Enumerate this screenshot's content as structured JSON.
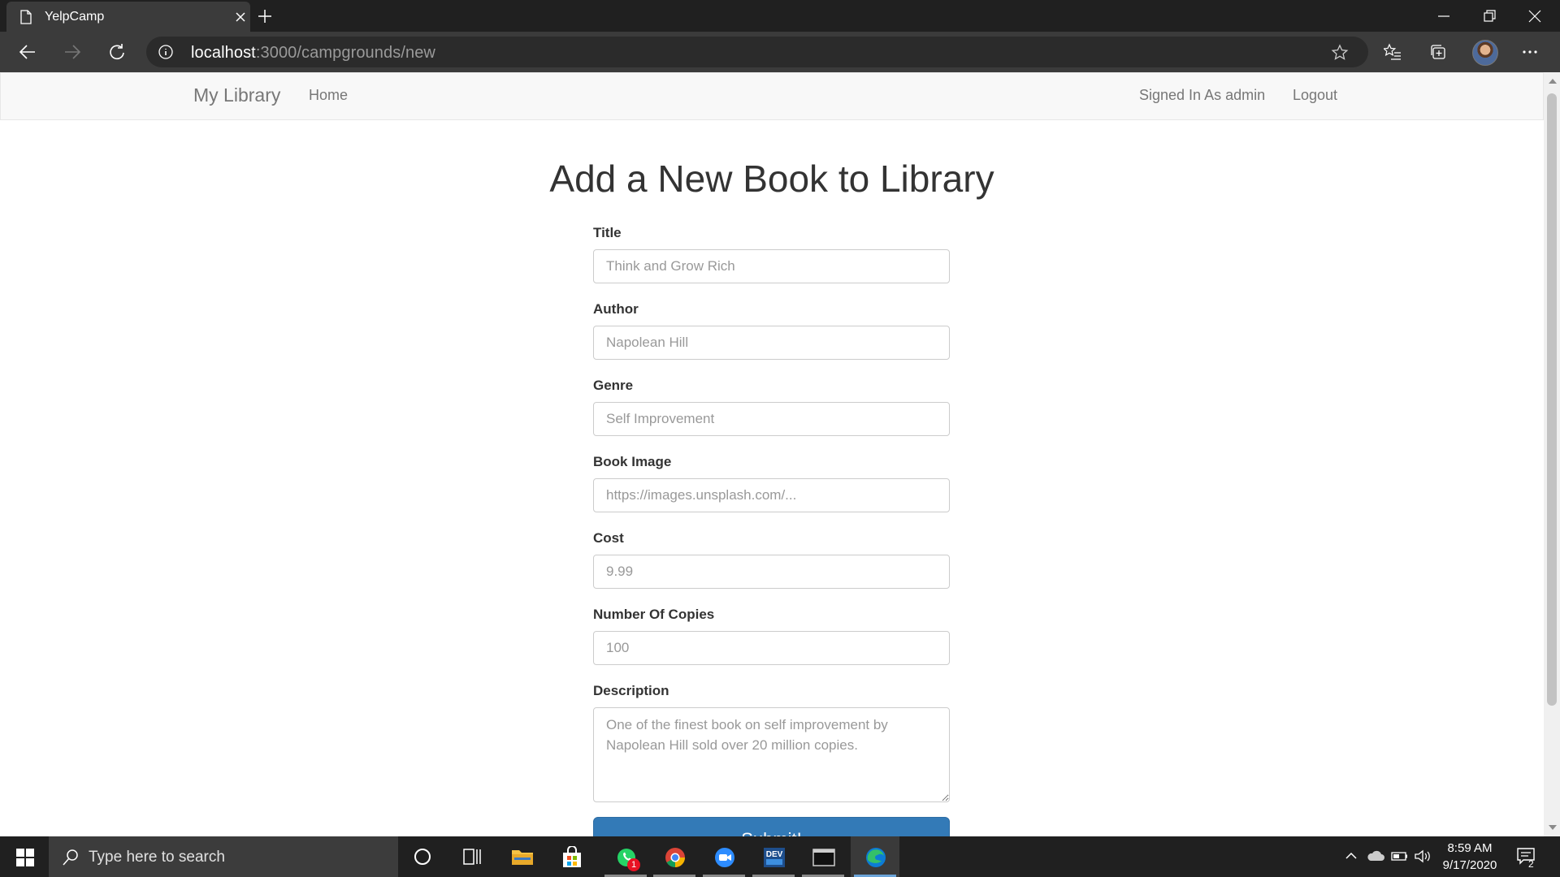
{
  "browser": {
    "tab_title": "YelpCamp",
    "url_host": "localhost",
    "url_path": ":3000/campgrounds/new"
  },
  "navbar": {
    "brand": "My Library",
    "home": "Home",
    "signed_in": "Signed In As admin",
    "logout": "Logout"
  },
  "form": {
    "heading": "Add a New Book to Library",
    "fields": [
      {
        "label": "Title",
        "placeholder": "Think and Grow Rich"
      },
      {
        "label": "Author",
        "placeholder": "Napolean Hill"
      },
      {
        "label": "Genre",
        "placeholder": "Self Improvement"
      },
      {
        "label": "Book Image",
        "placeholder": "https://images.unsplash.com/..."
      },
      {
        "label": "Cost",
        "placeholder": "9.99"
      },
      {
        "label": "Number Of Copies",
        "placeholder": "100"
      },
      {
        "label": "Description",
        "placeholder": "One of the finest book on self improvement by Napolean Hill sold over 20 million copies."
      }
    ],
    "submit": "Submit!"
  },
  "taskbar": {
    "search_placeholder": "Type here to search",
    "whatsapp_badge": "1",
    "time": "8:59 AM",
    "date": "9/17/2020",
    "notification_count": "2"
  },
  "colors": {
    "primary_button": "#337ab7",
    "navbar_bg": "#f8f8f8",
    "taskbar_bg": "#202020"
  }
}
